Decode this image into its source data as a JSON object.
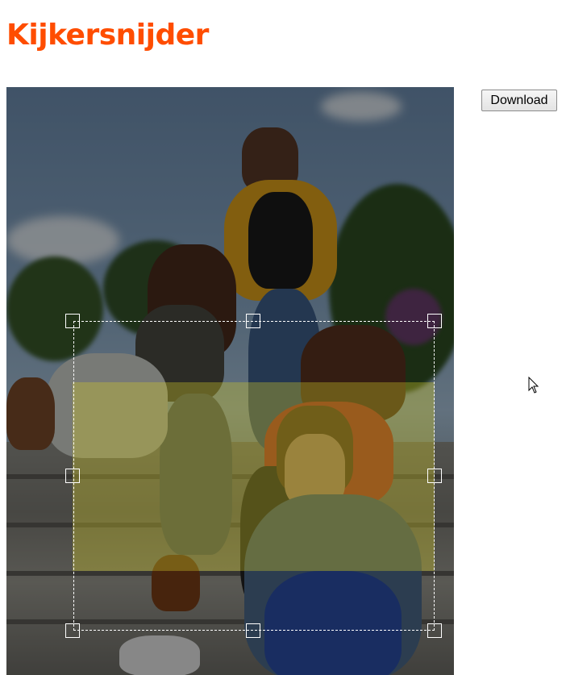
{
  "page": {
    "title": "Kijkersnijder"
  },
  "toolbar": {
    "download_label": "Download"
  },
  "image": {
    "alt": "Group of students sitting on stone steps outdoors",
    "crop_active": true
  },
  "colors": {
    "title": "#ff4d00",
    "selection_tint": "#d2c828",
    "crop_border": "#ffffff"
  },
  "icons": {
    "cursor": "mouse-pointer-icon"
  }
}
